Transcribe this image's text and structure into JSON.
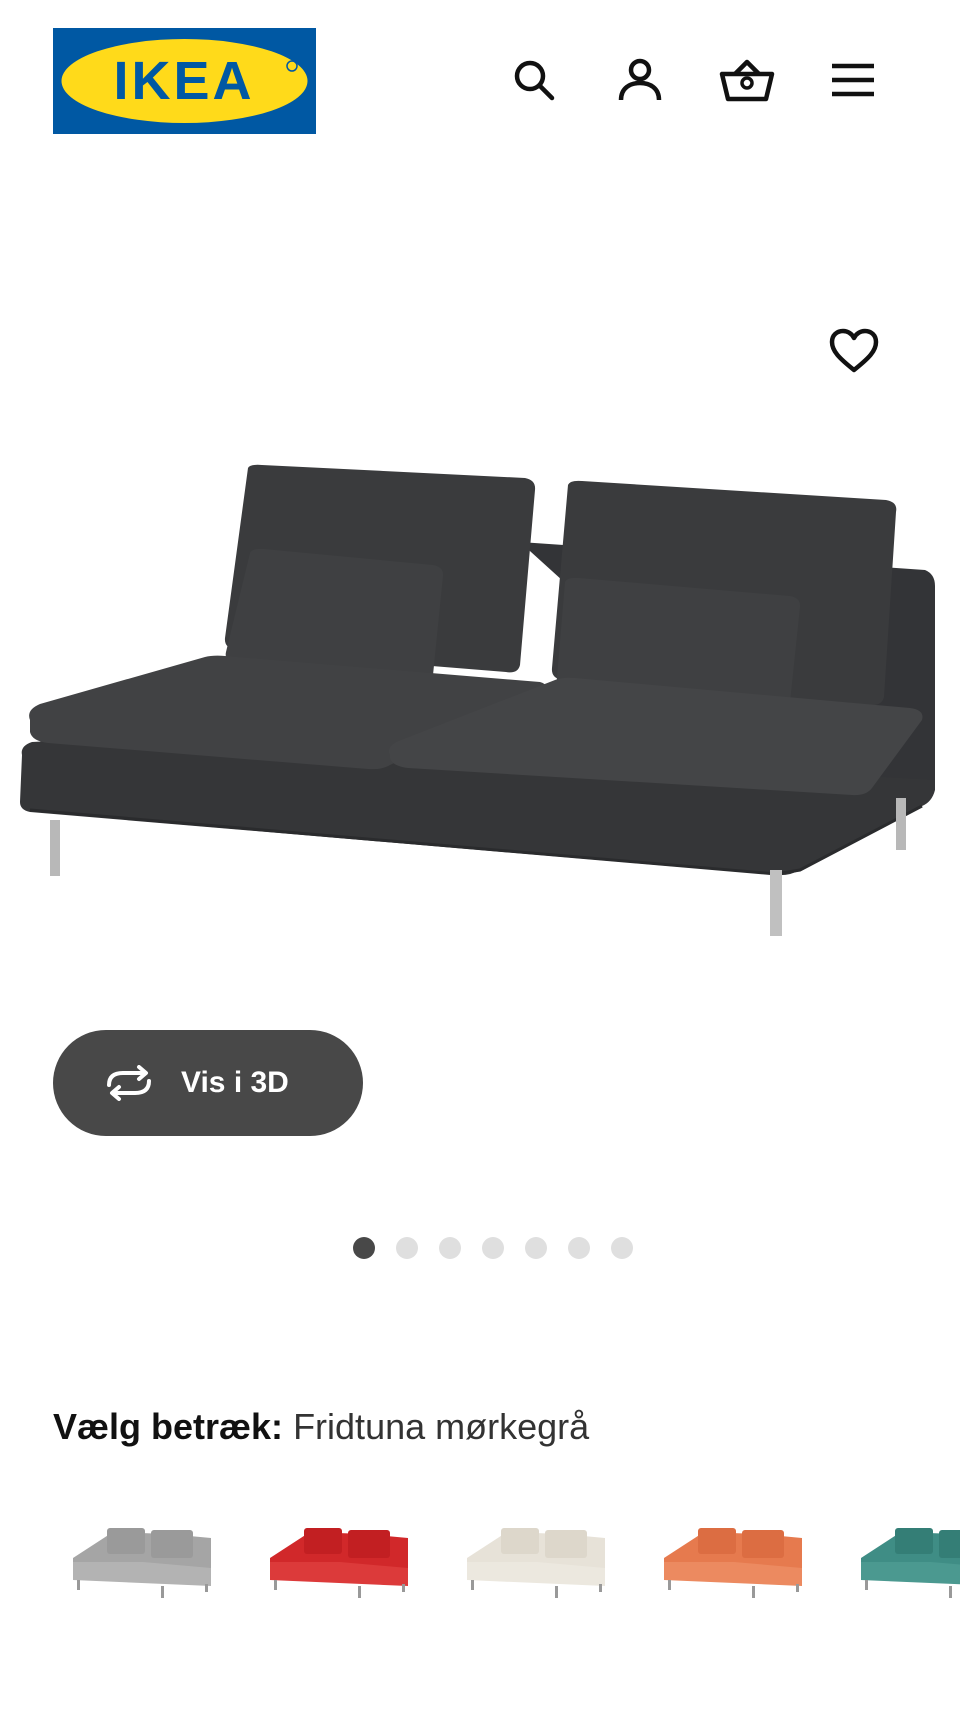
{
  "header": {
    "logo_text": "IKEA",
    "icons": [
      "search-icon",
      "user-icon",
      "basket-icon",
      "menu-icon"
    ]
  },
  "gallery": {
    "favorite_icon": "heart-icon",
    "view_3d_label": "Vis i 3D",
    "view_3d_icon": "rotate-icon",
    "dots_total": 7,
    "active_dot": 1
  },
  "cover": {
    "label": "Vælg betræk:",
    "value": "Fridtuna mørkegrå",
    "swatch_colors": [
      "#a5a5a5",
      "#d1282a",
      "#e7e2d8",
      "#e67a4e",
      "#3f8d85"
    ]
  },
  "colors": {
    "brand_blue": "#0058a3",
    "brand_yellow": "#ffda1a",
    "button_dark": "#484848",
    "sofa_dark": "#3a3b3d"
  }
}
